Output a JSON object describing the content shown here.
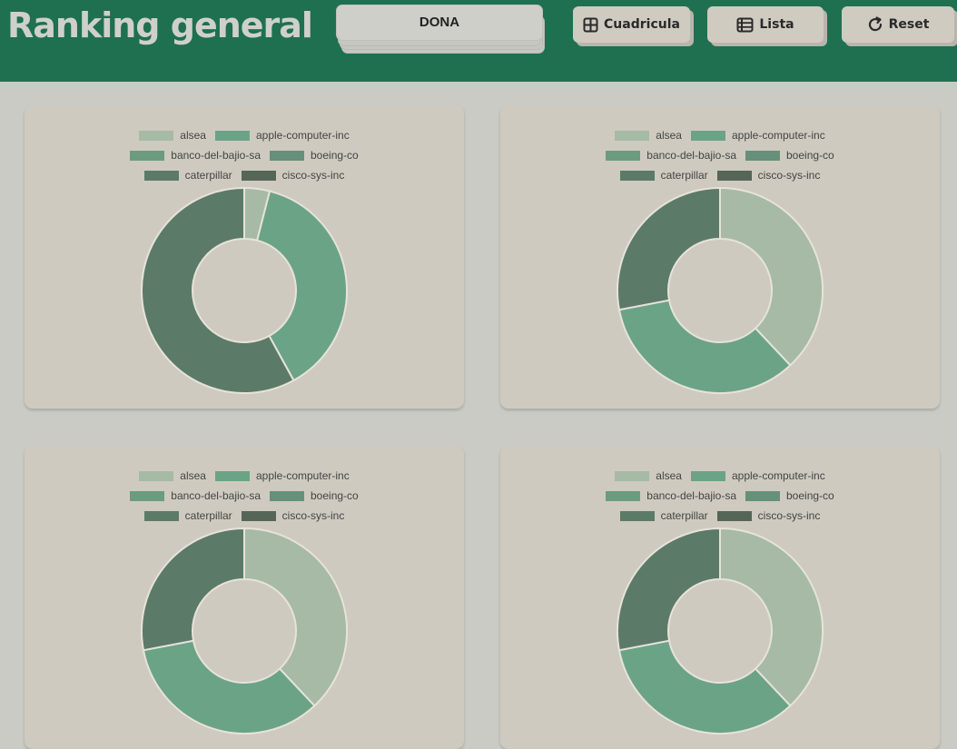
{
  "header": {
    "title": "Ranking general",
    "chart_type_select": "DONA",
    "buttons": [
      {
        "label": "Cuadricula",
        "icon": "grid-icon"
      },
      {
        "label": "Lista",
        "icon": "list-icon"
      },
      {
        "label": "Reset",
        "icon": "reset-icon"
      }
    ]
  },
  "colors": {
    "header_bg": "#1e7050",
    "page_bg": "#cbcbc6",
    "card_bg": "#cfcac0",
    "series": [
      "#a6baa5",
      "#6ba386",
      "#6b9c80",
      "#66907a",
      "#5c7a68",
      "#566656"
    ]
  },
  "chart_data": [
    {
      "type": "pie",
      "categories": [
        "alsea",
        "apple-computer-inc",
        "banco-del-bajio-sa",
        "boeing-co",
        "caterpillar",
        "cisco-sys-inc"
      ],
      "values": [
        4,
        38,
        0,
        0,
        58,
        0
      ]
    },
    {
      "type": "pie",
      "categories": [
        "alsea",
        "apple-computer-inc",
        "banco-del-bajio-sa",
        "boeing-co",
        "caterpillar",
        "cisco-sys-inc"
      ],
      "values": [
        38,
        34,
        0,
        0,
        28,
        0
      ]
    },
    {
      "type": "pie",
      "categories": [
        "alsea",
        "apple-computer-inc",
        "banco-del-bajio-sa",
        "boeing-co",
        "caterpillar",
        "cisco-sys-inc"
      ],
      "values": [
        38,
        34,
        0,
        0,
        28,
        0
      ]
    },
    {
      "type": "pie",
      "categories": [
        "alsea",
        "apple-computer-inc",
        "banco-del-bajio-sa",
        "boeing-co",
        "caterpillar",
        "cisco-sys-inc"
      ],
      "values": [
        38,
        34,
        0,
        0,
        28,
        0
      ]
    }
  ]
}
